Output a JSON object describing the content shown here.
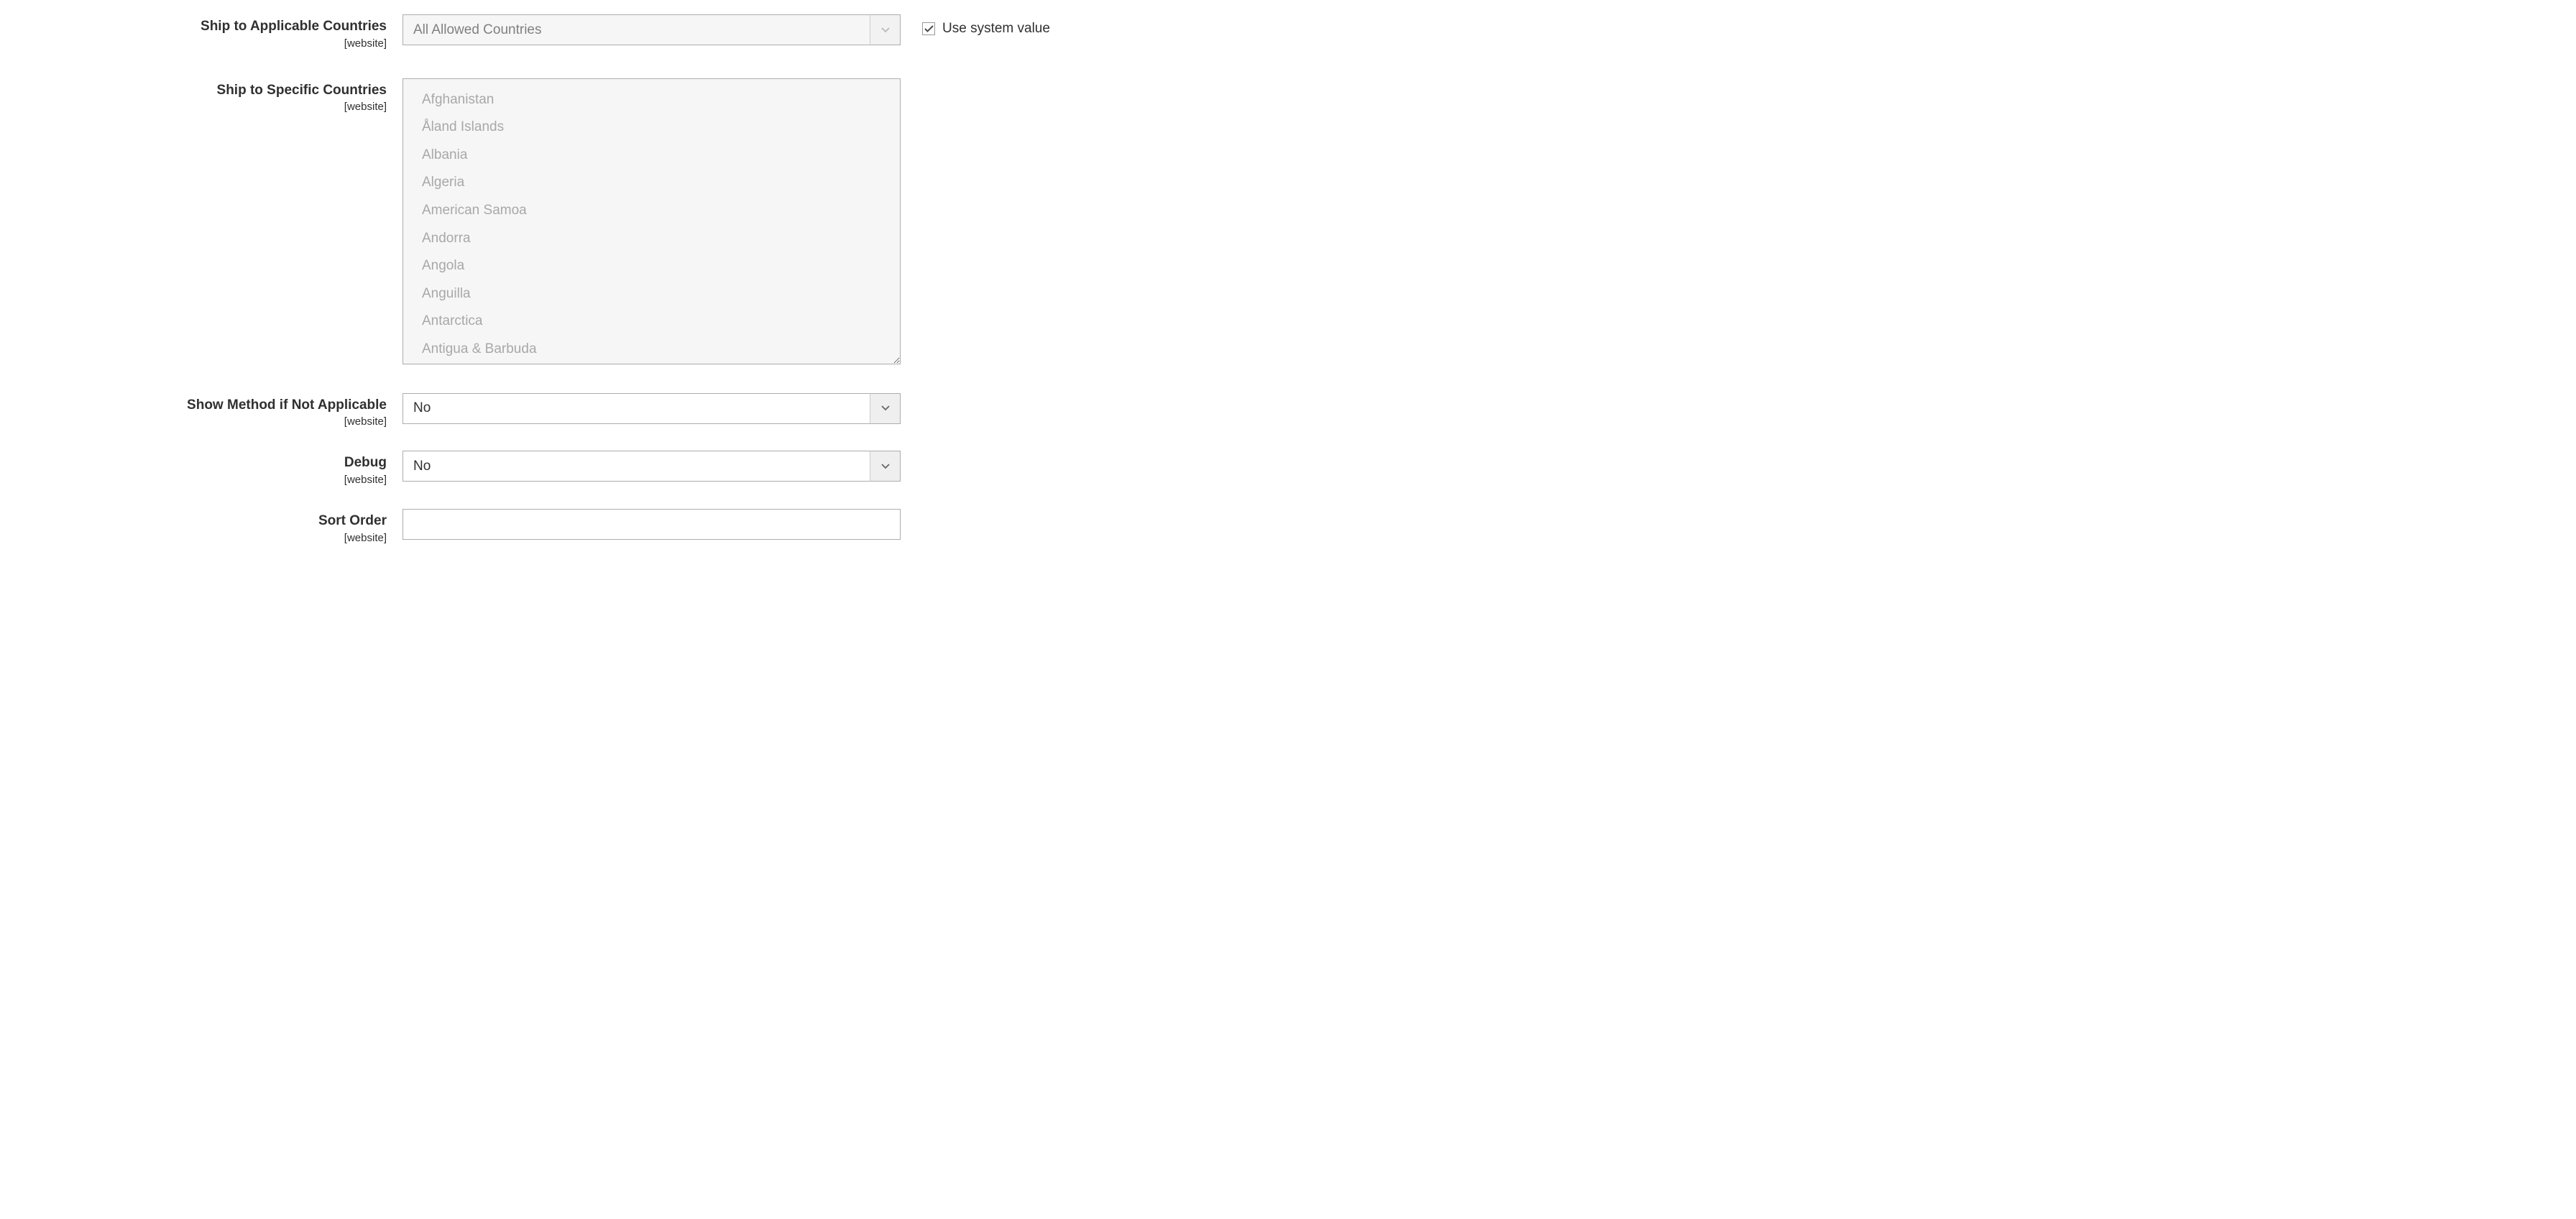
{
  "fields": {
    "ship_applicable": {
      "label": "Ship to Applicable Countries",
      "scope": "[website]",
      "value": "All Allowed Countries",
      "use_system_label": "Use system value"
    },
    "ship_specific": {
      "label": "Ship to Specific Countries",
      "scope": "[website]",
      "options": [
        "Afghanistan",
        "Åland Islands",
        "Albania",
        "Algeria",
        "American Samoa",
        "Andorra",
        "Angola",
        "Anguilla",
        "Antarctica",
        "Antigua & Barbuda"
      ]
    },
    "show_method": {
      "label": "Show Method if Not Applicable",
      "scope": "[website]",
      "value": "No"
    },
    "debug": {
      "label": "Debug",
      "scope": "[website]",
      "value": "No"
    },
    "sort_order": {
      "label": "Sort Order",
      "scope": "[website]",
      "value": ""
    }
  }
}
